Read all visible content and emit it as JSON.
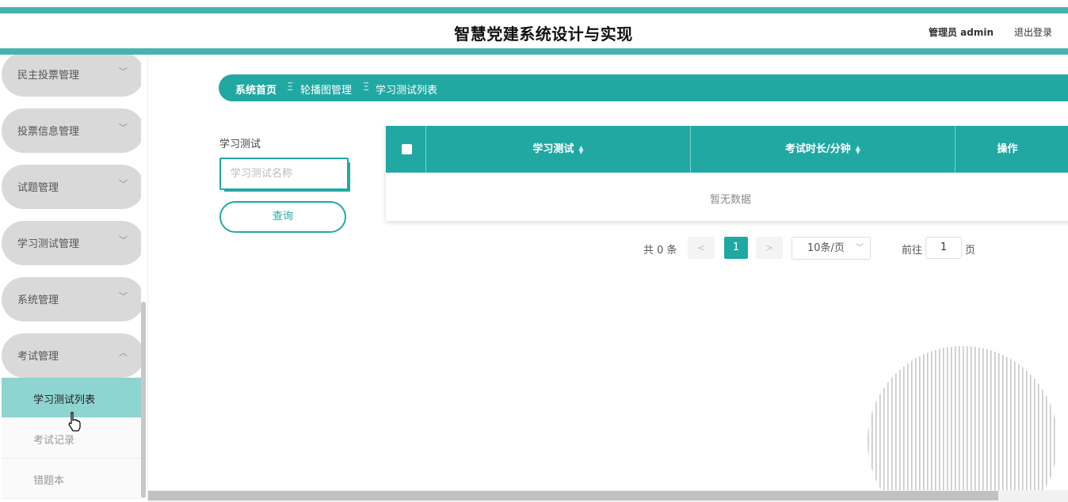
{
  "header": {
    "title": "智慧党建系统设计与实现",
    "user": "管理员 admin",
    "logout": "退出登录"
  },
  "sidebar": {
    "menus": [
      {
        "label": "民主投票管理",
        "expanded": false
      },
      {
        "label": "投票信息管理",
        "expanded": false
      },
      {
        "label": "试题管理",
        "expanded": false
      },
      {
        "label": "学习测试管理",
        "expanded": false
      },
      {
        "label": "系统管理",
        "expanded": false
      },
      {
        "label": "考试管理",
        "expanded": true
      }
    ],
    "subitems": [
      {
        "label": "学习测试列表",
        "active": true
      },
      {
        "label": "考试记录",
        "active": false
      },
      {
        "label": "错题本",
        "active": false
      }
    ]
  },
  "breadcrumb": {
    "home": "系统首页",
    "separator": "Ξ",
    "level2": "轮播图管理",
    "level3": "学习测试列表"
  },
  "search": {
    "label": "学习测试",
    "placeholder": "学习测试名称",
    "value": "",
    "button": "查询"
  },
  "table": {
    "columns": [
      "学习测试",
      "考试时长/分钟",
      "操作"
    ],
    "empty_text": "暂无数据"
  },
  "pagination": {
    "total": "共 0 条",
    "prev": "<",
    "current": "1",
    "next": ">",
    "page_size": "10条/页",
    "goto_label": "前往",
    "goto_value": "1",
    "goto_suffix": "页"
  },
  "colors": {
    "accent": "#22a8a3",
    "header_stripe": "#45b3b0",
    "active_sub": "#8ed4d0",
    "menu_pill": "#d9d9d9"
  }
}
